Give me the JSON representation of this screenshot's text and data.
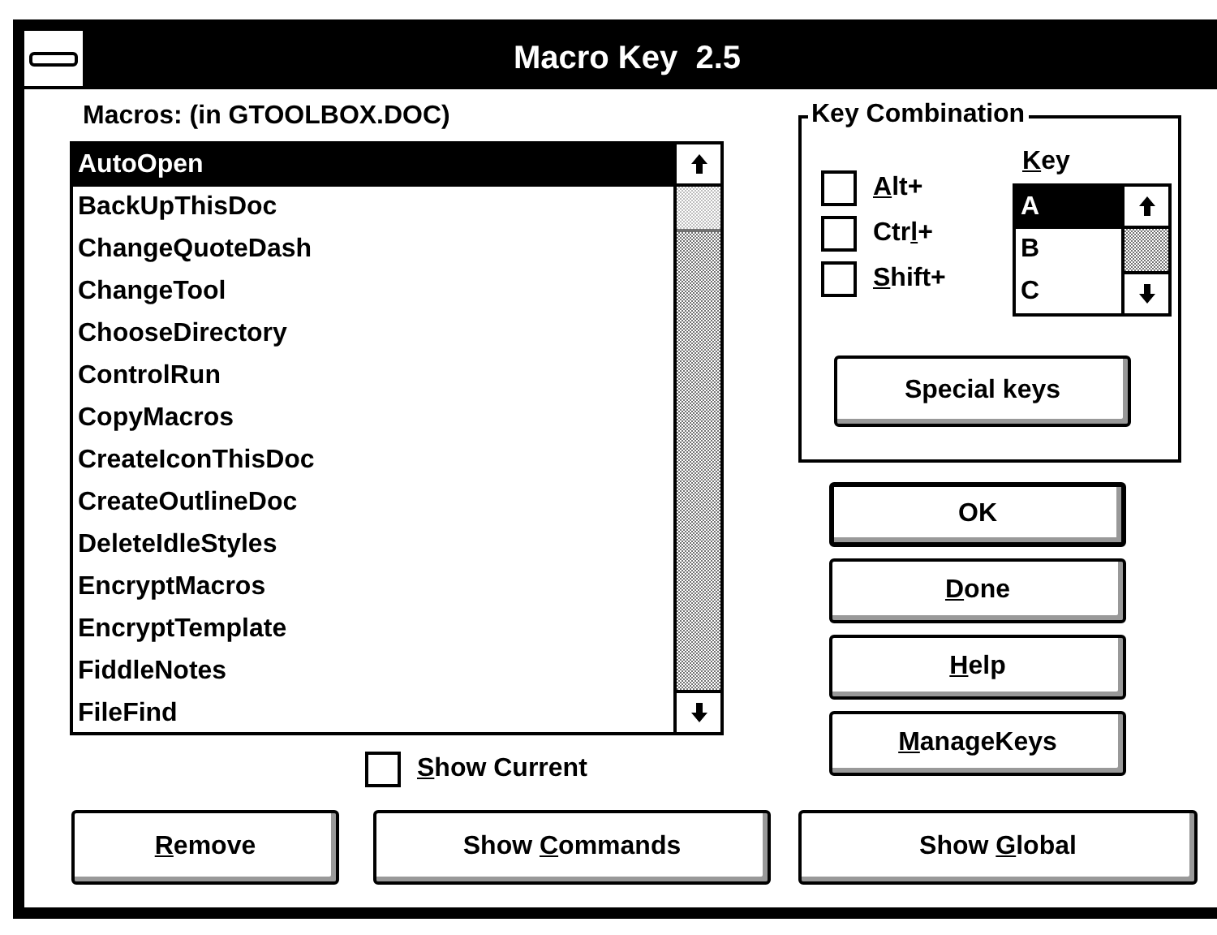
{
  "window": {
    "title": "Macro Key  2.5"
  },
  "macros": {
    "label": "Macros: (in GTOOLBOX.DOC)",
    "items": [
      {
        "name": "AutoOpen",
        "selected": true
      },
      {
        "name": "BackUpThisDoc",
        "selected": false
      },
      {
        "name": "ChangeQuoteDash",
        "selected": false
      },
      {
        "name": "ChangeTool",
        "selected": false
      },
      {
        "name": "ChooseDirectory",
        "selected": false
      },
      {
        "name": "ControlRun",
        "selected": false
      },
      {
        "name": "CopyMacros",
        "selected": false
      },
      {
        "name": "CreateIconThisDoc",
        "selected": false
      },
      {
        "name": "CreateOutlineDoc",
        "selected": false
      },
      {
        "name": "DeleteIdleStyles",
        "selected": false
      },
      {
        "name": "EncryptMacros",
        "selected": false
      },
      {
        "name": "EncryptTemplate",
        "selected": false
      },
      {
        "name": "FiddleNotes",
        "selected": false
      },
      {
        "name": "FileFind",
        "selected": false
      }
    ]
  },
  "key_combination": {
    "title": "Key Combination",
    "modifiers": [
      {
        "label": {
          "key": "A",
          "post": "lt+"
        },
        "checked": false
      },
      {
        "label": {
          "pre": "Ctr",
          "key": "l",
          "post": "+"
        },
        "checked": false
      },
      {
        "label": {
          "key": "S",
          "post": "hift+"
        },
        "checked": false
      }
    ],
    "key_list": {
      "label": {
        "key": "K",
        "post": "ey"
      },
      "items": [
        {
          "name": "A",
          "selected": true
        },
        {
          "name": "B",
          "selected": false
        },
        {
          "name": "C",
          "selected": false
        }
      ]
    },
    "special_keys_button": {
      "pre": "Special keys"
    }
  },
  "side_buttons": [
    {
      "label": {
        "pre": "OK"
      },
      "default": true
    },
    {
      "label": {
        "key": "D",
        "post": "one"
      },
      "default": false
    },
    {
      "label": {
        "key": "H",
        "post": "elp"
      },
      "default": false
    },
    {
      "label": {
        "key": "M",
        "post": "anageKeys"
      },
      "default": false
    }
  ],
  "show_current": {
    "label": {
      "key": "S",
      "post": "how Current"
    },
    "checked": false
  },
  "bottom_buttons": [
    {
      "label": {
        "key": "R",
        "post": "emove"
      }
    },
    {
      "label": {
        "pre": "Show ",
        "key": "C",
        "post": "ommands"
      }
    },
    {
      "label": {
        "pre": "Show ",
        "key": "G",
        "post": "lobal"
      }
    }
  ]
}
